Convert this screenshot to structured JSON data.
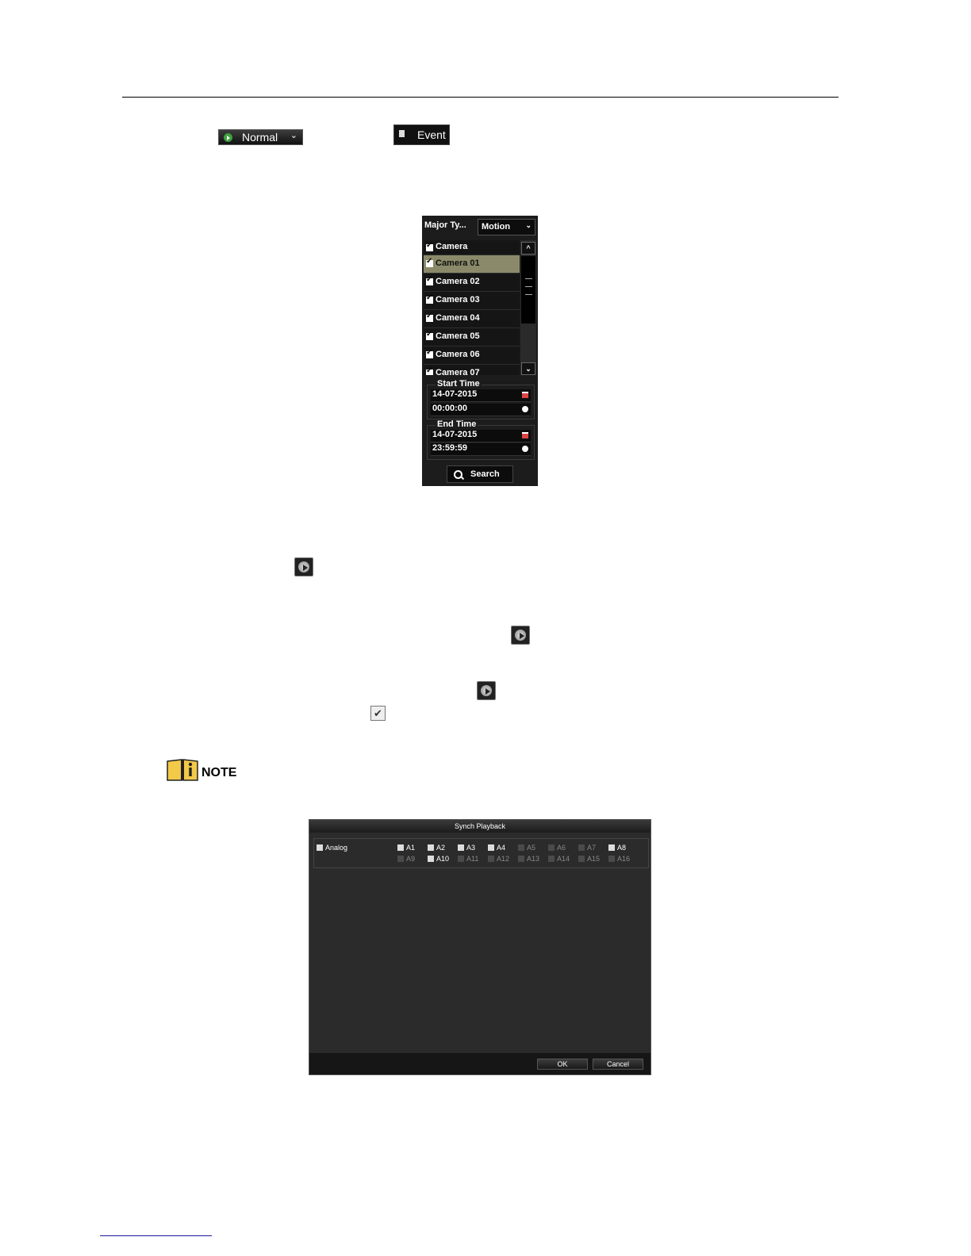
{
  "toolbar": {
    "normal_label": "Normal",
    "event_label": "Event"
  },
  "search_panel": {
    "major_type_label": "Major Ty...",
    "major_type_value": "Motion",
    "camera_header": "Camera",
    "cameras": [
      "Camera 01",
      "Camera 02",
      "Camera 03",
      "Camera 04",
      "Camera 05",
      "Camera 06",
      "Camera 07"
    ],
    "start_time_label": "Start Time",
    "start_date": "14-07-2015",
    "start_time": "00:00:00",
    "end_time_label": "End Time",
    "end_date": "14-07-2015",
    "end_time": "23:59:59",
    "search_label": "Search"
  },
  "note": {
    "label": "NOTE"
  },
  "synch_dialog": {
    "title": "Synch Playback",
    "analog_label": "Analog",
    "channels_row1": [
      "A1",
      "A2",
      "A3",
      "A4",
      "A5",
      "A6",
      "A7",
      "A8"
    ],
    "channels_row2": [
      "A9",
      "A10",
      "A11",
      "A12",
      "A13",
      "A14",
      "A15",
      "A16"
    ],
    "ok_label": "OK",
    "cancel_label": "Cancel"
  }
}
